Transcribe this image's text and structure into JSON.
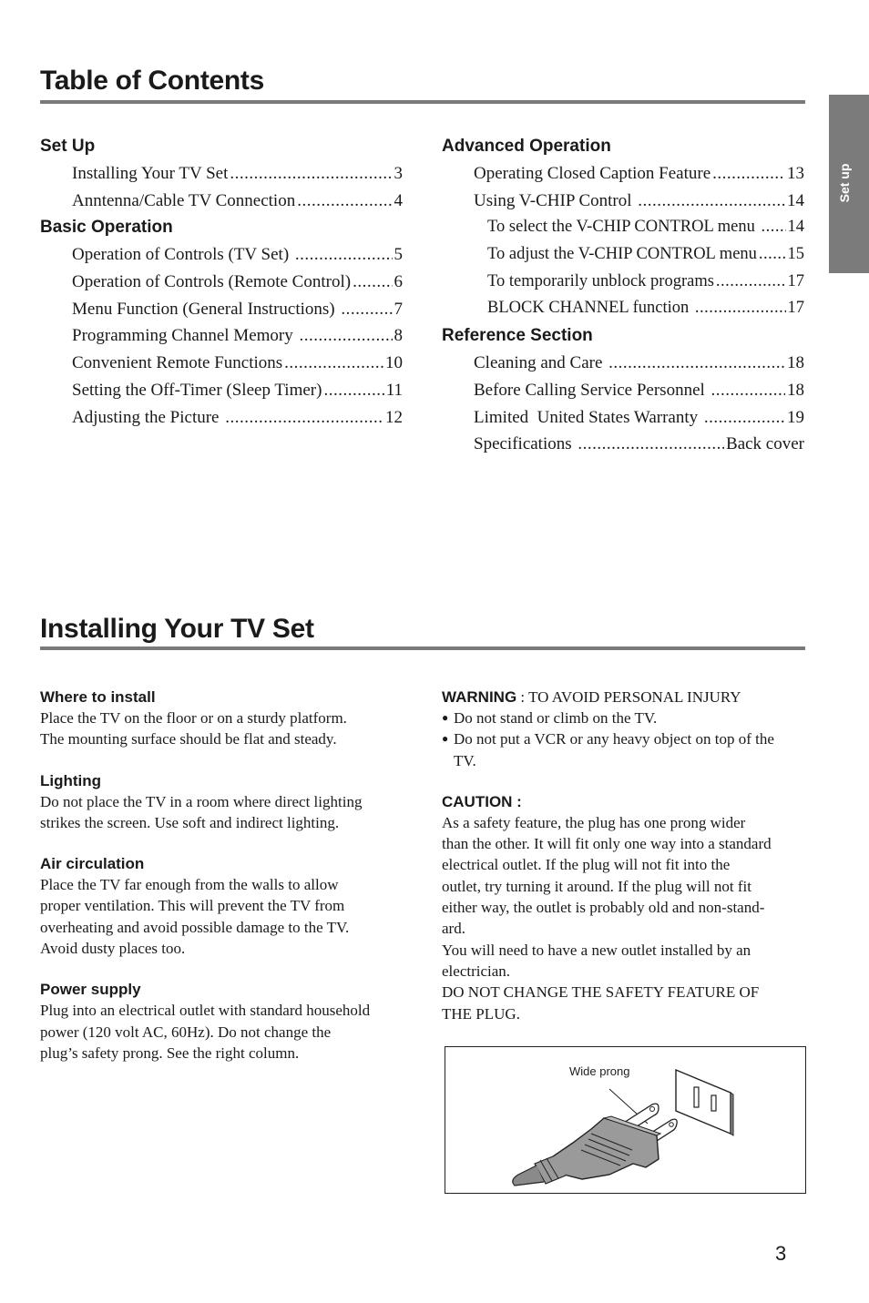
{
  "toc": {
    "title": "Table of Contents",
    "left_sections": [
      {
        "title": "Set Up",
        "items": [
          {
            "label": "Installing Your TV Set",
            "page": "3"
          },
          {
            "label": "Anntenna/Cable TV Connection",
            "page": "4"
          }
        ]
      },
      {
        "title": "Basic Operation",
        "items": [
          {
            "label": "Operation of Controls (TV Set) ",
            "page": "5"
          },
          {
            "label": "Operation of Controls (Remote Control)",
            "page": "6"
          },
          {
            "label": "Menu Function (General Instructions) ",
            "page": "7"
          },
          {
            "label": "Programming Channel Memory ",
            "page": "8"
          },
          {
            "label": "Convenient Remote Functions",
            "page": "10"
          },
          {
            "label": "Setting the Off-Timer (Sleep Timer)",
            "page": " 11"
          },
          {
            "label": "Adjusting the Picture ",
            "page": "12"
          }
        ]
      }
    ],
    "right_sections": [
      {
        "title": "Advanced Operation",
        "items": [
          {
            "label": "Operating Closed Caption Feature",
            "page": "13",
            "sub": false
          },
          {
            "label": "Using V-CHIP Control ",
            "page": "14",
            "sub": false
          },
          {
            "label": "To select the V-CHIP CONTROL menu ",
            "page": "14",
            "sub": true
          },
          {
            "label": "To adjust the V-CHIP CONTROL menu",
            "page": "15",
            "sub": true
          },
          {
            "label": "To temporarily unblock programs",
            "page": "17",
            "sub": true
          },
          {
            "label": "BLOCK CHANNEL function ",
            "page": "17",
            "sub": true
          }
        ]
      },
      {
        "title": "Reference Section",
        "items": [
          {
            "label": "Cleaning and Care ",
            "page": "18",
            "sub": false
          },
          {
            "label": "Before Calling Service Personnel ",
            "page": "18",
            "sub": false
          },
          {
            "label": "Limited  United States Warranty ",
            "page": "19",
            "sub": false
          },
          {
            "label": "Specifications ",
            "page": " Back cover",
            "sub": false
          }
        ]
      }
    ]
  },
  "side_tab": {
    "label": "Set up"
  },
  "install": {
    "title": "Installing Your TV Set",
    "left": [
      {
        "heading": "Where to install",
        "lines": [
          "Place the TV on the floor or on a sturdy platform.",
          "The mounting surface should be flat and steady."
        ]
      },
      {
        "heading": "Lighting",
        "lines": [
          "Do not place the TV in a room where direct lighting",
          "strikes the screen. Use soft and indirect lighting."
        ]
      },
      {
        "heading": "Air circulation",
        "lines": [
          "Place the TV far enough from the walls to allow",
          "proper ventilation. This will prevent the TV from",
          "overheating and avoid possible damage to the TV.",
          "Avoid dusty places too."
        ]
      },
      {
        "heading": "Power supply",
        "lines": [
          "Plug into an electrical outlet with standard household",
          "power (120 volt AC, 60Hz). Do not change the",
          "plug’s safety prong. See the right column."
        ]
      }
    ],
    "warning": {
      "label": "WARNING",
      "text": " : TO AVOID PERSONAL INJURY",
      "bullets": [
        "Do not stand or climb on the TV.",
        "Do not put a VCR or any heavy object on top of the TV."
      ]
    },
    "caution": {
      "label": "CAUTION :",
      "lines": [
        "As a safety feature, the plug has one prong wider",
        "than the other. It will fit only one way into a standard",
        "electrical outlet. If the plug will not fit into the",
        "outlet, try turning it around. If the plug will not fit",
        "either way, the outlet is probably old and non-stand-",
        "ard.",
        "You will need to have a new outlet installed by an",
        "electrician.",
        "DO NOT CHANGE THE SAFETY FEATURE OF",
        "THE PLUG."
      ]
    },
    "figure": {
      "callout": "Wide prong"
    }
  },
  "page_number": "3"
}
